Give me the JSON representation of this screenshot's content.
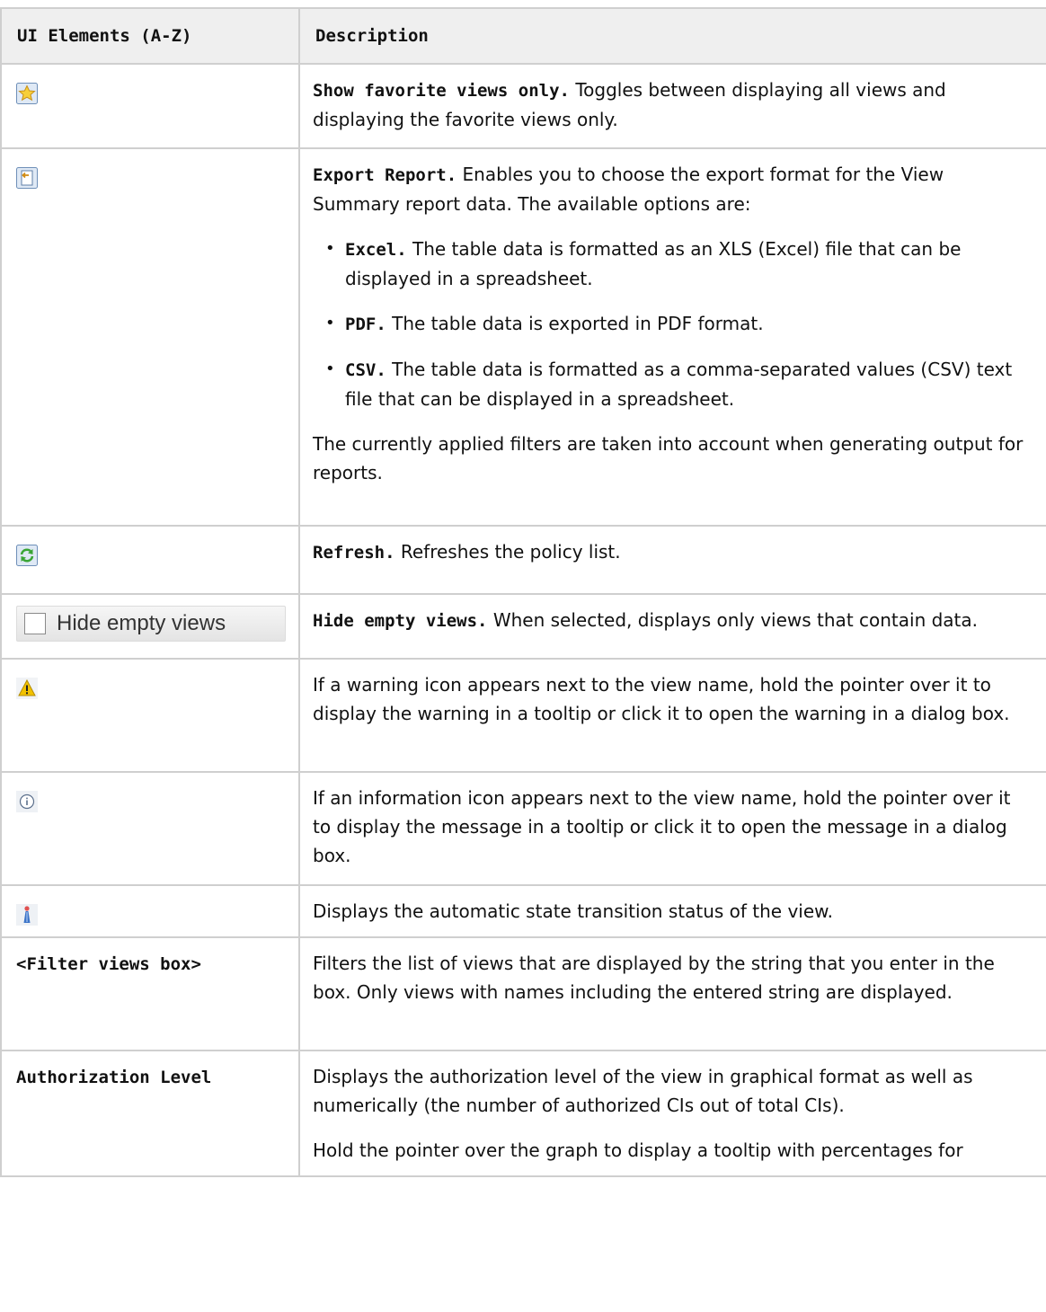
{
  "table": {
    "headers": {
      "col1": "UI Elements (A-Z)",
      "col2": "Description"
    },
    "rows": [
      {
        "icon": "star-favorite-icon",
        "desc_bold": "Show favorite views only.",
        "desc": " Toggles between displaying all views and displaying the favorite views only."
      },
      {
        "icon": "export-report-icon",
        "desc_bold": "Export Report.",
        "desc": " Enables you to choose the export format for the View Summary report data. The available options are:",
        "bullets": [
          {
            "bold": "Excel.",
            "text": " The table data is formatted as an XLS (Excel) file that can be displayed in a spreadsheet."
          },
          {
            "bold": "PDF.",
            "text": " The table data is exported in PDF format."
          },
          {
            "bold": "CSV.",
            "text": " The table data is formatted as a comma-separated values (CSV) text file that can be displayed in a spreadsheet."
          }
        ],
        "note": "The currently applied filters are taken into account when generating output for reports."
      },
      {
        "icon": "refresh-icon",
        "desc_bold": "Refresh.",
        "desc": " Refreshes the policy list."
      },
      {
        "control_label": "Hide empty views",
        "desc_bold": "Hide empty views.",
        "desc": " When selected, displays only views that contain data."
      },
      {
        "icon": "warning-icon",
        "desc": "If a warning icon appears next to the view name, hold the pointer over it to display the warning in a tooltip or click it to open the warning in a dialog box."
      },
      {
        "icon": "info-icon",
        "desc": "If an information icon appears next to the view name, hold the pointer over it to display the message in a tooltip or click it to open the message in a dialog box."
      },
      {
        "icon": "state-transition-icon",
        "desc": "Displays the automatic state transition status of the view."
      },
      {
        "label": "<Filter views box>",
        "desc": "Filters the list of views that are displayed by the string that you enter in the box. Only views with names including the entered string are displayed."
      },
      {
        "label": "Authorization Level",
        "desc": "Displays the authorization level of the view in graphical format as well as numerically (the number of authorized CIs out of total CIs).",
        "note": "Hold the pointer over the graph to display a tooltip with percentages for"
      }
    ]
  },
  "colors": {
    "header_bg": "#efefef",
    "border": "#cfcfcf",
    "refresh_green": "#3aa535",
    "warning_yellow": "#f2c200"
  }
}
